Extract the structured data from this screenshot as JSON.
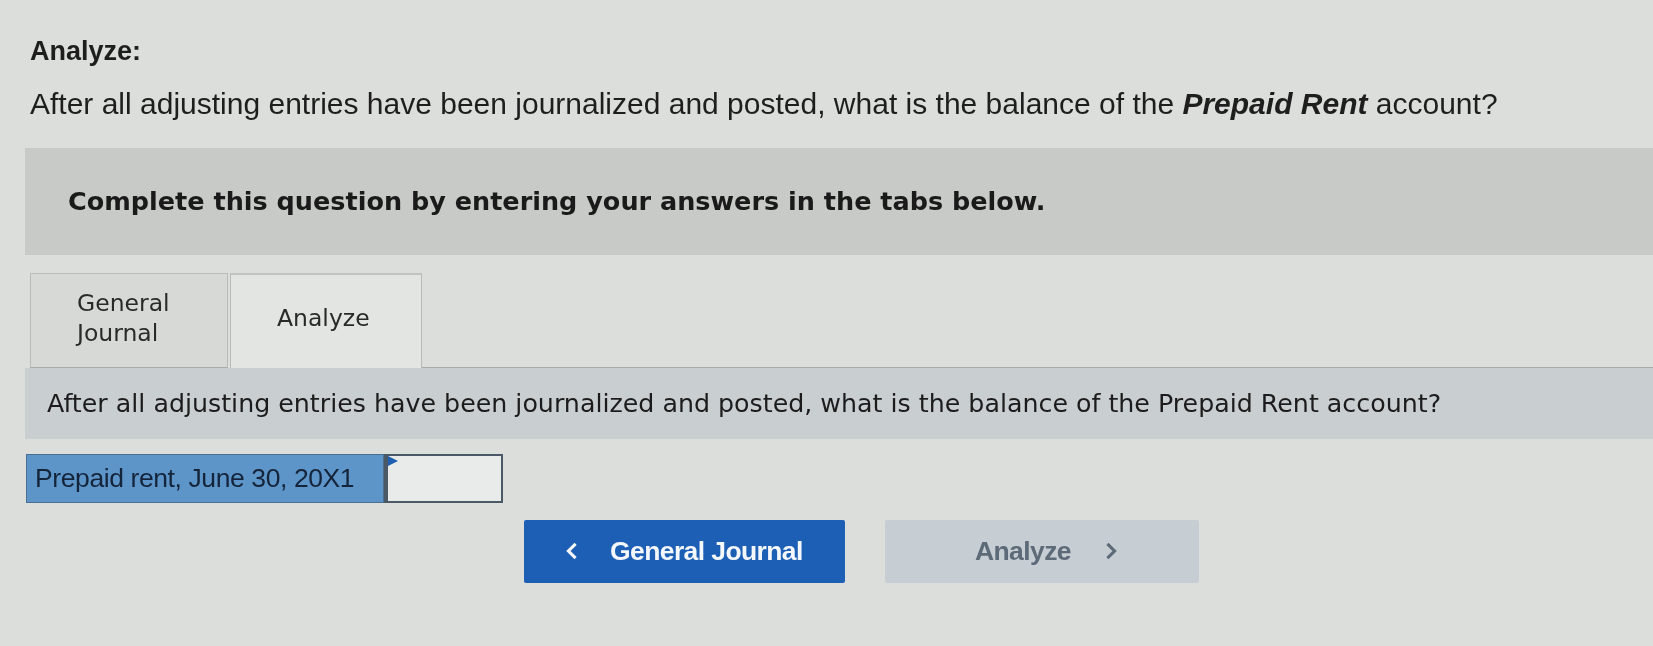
{
  "heading": "Analyze:",
  "question": "After all adjusting entries have been journalized and posted, what is the balance of the **Prepaid Rent** account?",
  "instructions": "Complete this question by entering your answers in the tabs below.",
  "tabs": [
    {
      "label": "General Journal",
      "selected": false
    },
    {
      "label": "Analyze",
      "selected": true
    }
  ],
  "tab_prompt": "After all adjusting entries have been journalized and posted, what is the balance of the Prepaid Rent account?",
  "answer_rows": [
    {
      "label": "Prepaid rent, June 30, 20X1"
    }
  ],
  "nav_buttons": [
    {
      "kind": "prev",
      "label": "General Journal",
      "disabled": false
    },
    {
      "kind": "next",
      "label": "Analyze",
      "disabled": true
    }
  ]
}
